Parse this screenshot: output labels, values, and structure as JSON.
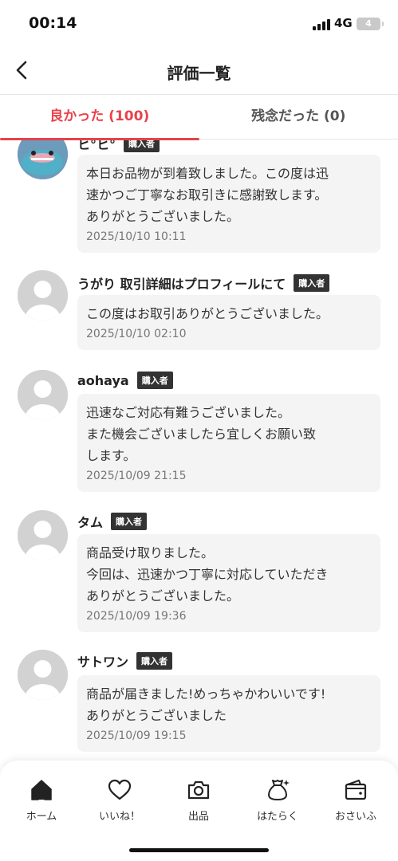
{
  "status_bar": {
    "time": "00:14",
    "network": "4G",
    "battery": "4"
  },
  "header": {
    "title": "評価一覧"
  },
  "tabs": [
    {
      "label": "良かった (100)",
      "active": true
    },
    {
      "label": "残念だった (0)",
      "active": false
    }
  ],
  "reviews": [
    {
      "name": "ヒ°ヒ°",
      "badge": "購入者",
      "comment": "本日お品物が到着致しました。この度は迅\n速かつご丁寧なお取引きに感謝致します。\nありがとうございました。",
      "date": "2025/10/10 10:11"
    },
    {
      "name": "うがり 取引詳細はプロフィールにて",
      "badge": "購入者",
      "comment": "この度はお取引ありがとうございました。",
      "date": "2025/10/10 02:10"
    },
    {
      "name": "aohaya",
      "badge": "購入者",
      "comment": "迅速なご対応有難うございました。\nまた機会ございましたら宜しくお願い致\nします。",
      "date": "2025/10/09 21:15"
    },
    {
      "name": "タム",
      "badge": "購入者",
      "comment": "商品受け取りました。\n今回は、迅速かつ丁寧に対応していただき\nありがとうございました。",
      "date": "2025/10/09 19:36"
    },
    {
      "name": "サトワン",
      "badge": "購入者",
      "comment": "商品が届きました!めっちゃかわいいです!\nありがとうございました",
      "date": "2025/10/09 19:15"
    }
  ],
  "bottom_nav": [
    {
      "label": "ホーム",
      "icon": "home-icon"
    },
    {
      "label": "いいね！",
      "icon": "heart-icon"
    },
    {
      "label": "出品",
      "icon": "camera-icon"
    },
    {
      "label": "はたらく",
      "icon": "money-bag-icon"
    },
    {
      "label": "おさいふ",
      "icon": "wallet-icon"
    }
  ],
  "colors": {
    "accent": "#e8414b",
    "badge_bg": "#333333",
    "bubble_bg": "#f4f4f4"
  }
}
